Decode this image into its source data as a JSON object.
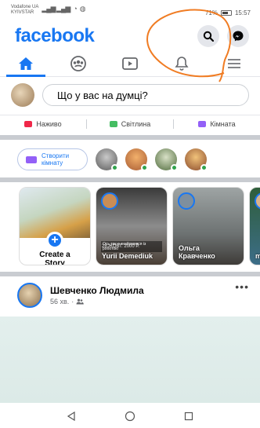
{
  "status_bar": {
    "carrier_line1": "Vodafone UA",
    "carrier_line2": "KYIVSTAR",
    "battery_percent": "71%",
    "battery_level": 0.71,
    "time": "15:57"
  },
  "header": {
    "logo": "facebook",
    "search_icon": "search-icon",
    "messenger_icon": "messenger-icon"
  },
  "nav": {
    "tabs": [
      {
        "icon": "home-icon",
        "active": true
      },
      {
        "icon": "groups-icon",
        "active": false
      },
      {
        "icon": "watch-icon",
        "active": false
      },
      {
        "icon": "bell-icon",
        "active": false
      },
      {
        "icon": "menu-icon",
        "active": false
      }
    ]
  },
  "composer": {
    "placeholder": "Що у вас на думці?"
  },
  "actions": {
    "live": "Наживо",
    "photo": "Світлина",
    "room": "Кімната"
  },
  "rooms": {
    "create_label": "Створити кімнату"
  },
  "stories": {
    "create_line1": "Create a",
    "create_line2": "Story",
    "items": [
      {
        "name": "Yurii Demediuk",
        "date": "28 ЖОВТ. 2000 Р.",
        "caption": "Ось так я знайомився із роботою"
      },
      {
        "name_line1": "Ольга",
        "name_line2": "Кравченко"
      },
      {
        "name": "m"
      }
    ]
  },
  "post": {
    "author": "Шевченко Людмила",
    "time": "56 хв.",
    "more": "•••"
  },
  "colors": {
    "brand": "#1877f2",
    "live": "#f02849",
    "photo": "#45bd62",
    "room": "#9360f7",
    "online": "#31a24c"
  }
}
